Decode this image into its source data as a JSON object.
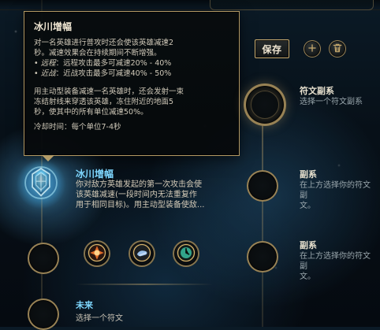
{
  "tooltip": {
    "title": "冰川增幅",
    "p1_line1": "对一名英雄进行普攻时还会使该英雄减速2",
    "p1_line2": "秒。减速效果会在持续期间不断增强。",
    "bullets": [
      {
        "label": "远程",
        "text": "：远程攻击最多可减速20% - 40%"
      },
      {
        "label": "近战",
        "text": "：近战攻击最多可减速40% - 50%"
      }
    ],
    "p2_line1": "用主动型装备减速一名英雄时，还会发射一束",
    "p2_line2": "冻结射线来穿透该英雄，冻住附近的地面5",
    "p2_line3": "秒，使其中的所有单位减速50%。",
    "cooldown": "冷却时间：每个单位7-4秒"
  },
  "actions": {
    "save_label": "保存"
  },
  "keystone": {
    "name": "冰川增幅",
    "desc": "你对敌方英雄发起的第一次攻击会使\n该英雄减速(一段时间内无法重复作\n用于相同目标)。用主动型装备使敌..."
  },
  "left_bottom": {
    "title": "未来",
    "subtitle": "选择一个符文"
  },
  "right": [
    {
      "title": "符文副系",
      "subtitle": "选择一个符文副系"
    },
    {
      "title": "副系",
      "subtitle": "在上方选择你的符文副\n文。"
    },
    {
      "title": "副系",
      "subtitle": "在上方选择你的符文副\n文。"
    }
  ],
  "icons": {
    "add": "plus-icon",
    "delete": "trash-icon",
    "keystone": "glacial-augment-icon",
    "rune_options": [
      "hextech-flashtraption-icon",
      "magical-footwear-icon",
      "perfect-timing-icon"
    ]
  },
  "colors": {
    "gold": "#c8aa6e",
    "cyan": "#7ed7ff"
  }
}
